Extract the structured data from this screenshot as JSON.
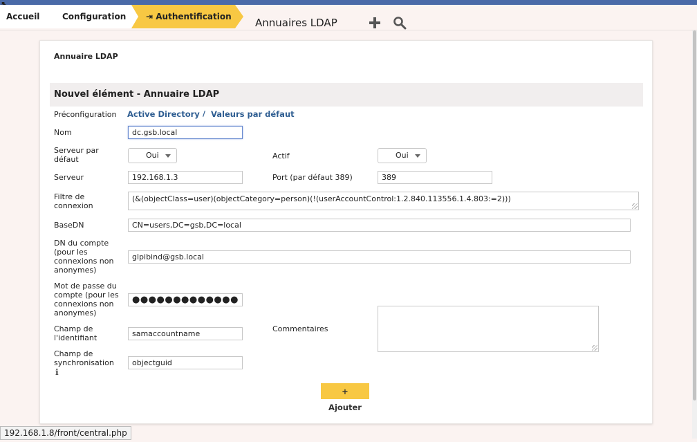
{
  "breadcrumb": {
    "home": "Accueil",
    "config": "Configuration",
    "auth": "Authentification"
  },
  "page_title": "Annuaires LDAP",
  "icons": {
    "add": "plus-icon",
    "search": "search-icon",
    "info": "info-icon"
  },
  "panel": {
    "tab_label": "Annuaire LDAP",
    "form_title": "Nouvel élément - Annuaire LDAP"
  },
  "form": {
    "preconfig_label": "Préconfiguration",
    "preconfig_links": [
      "Active Directory",
      "Valeurs par défaut"
    ],
    "preconfig_sep": "/",
    "name_label": "Nom",
    "name_value": "dc.gsb.local",
    "default_server_label": "Serveur par défaut",
    "default_server_value": "Oui",
    "active_label": "Actif",
    "active_value": "Oui",
    "server_label": "Serveur",
    "server_value": "192.168.1.3",
    "port_label": "Port (par défaut 389)",
    "port_value": "389",
    "filter_label": "Filtre de connexion",
    "filter_value": "(&(objectClass=user)(objectCategory=person)(!(userAccountControl:1.2.840.113556.1.4.803:=2)))",
    "basedn_label": "BaseDN",
    "basedn_value": "CN=users,DC=gsb,DC=local",
    "rootdn_label": "DN du compte (pour les connexions non anonymes)",
    "rootdn_value": "glpibind@gsb.local",
    "password_label": "Mot de passe du compte (pour les connexions non anonymes)",
    "password_value": "●●●●●●●●●●●●●",
    "login_field_label": "Champ de l'identifiant",
    "login_field_value": "samaccountname",
    "comments_label": "Commentaires",
    "comments_value": "",
    "sync_field_label": "Champ de synchronisation",
    "sync_field_value": "objectguid",
    "add_button": "+ Ajouter"
  },
  "status_bar": "192.168.1.8/front/central.php",
  "colors": {
    "accent": "#f8c843",
    "link": "#2f5e92",
    "top_strip": "#4a6aa8"
  }
}
